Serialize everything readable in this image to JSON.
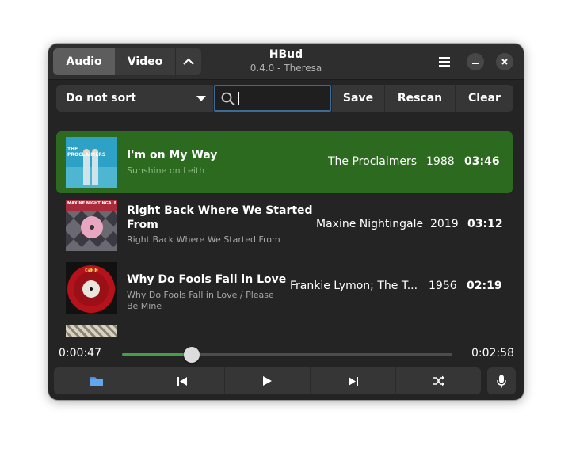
{
  "app": {
    "title": "HBud",
    "subtitle": "0.4.0 - Theresa"
  },
  "header": {
    "tabs": [
      {
        "label": "Audio",
        "active": true
      },
      {
        "label": "Video",
        "active": false
      }
    ],
    "collapse_icon": "chevron-up-icon",
    "menu_icon": "hamburger-menu-icon",
    "minimize_icon": "minimize-icon",
    "close_icon": "close-icon"
  },
  "toolbar": {
    "sort_value": "Do not sort",
    "search_value": "",
    "save_label": "Save",
    "rescan_label": "Rescan",
    "clear_label": "Clear"
  },
  "tracks": [
    {
      "title": "I'm on My Way",
      "title_line2": "",
      "album": "Sunshine on Leith",
      "album_line2": "",
      "artist": "The Proclaimers",
      "year": "1988",
      "duration": "03:46",
      "selected": true,
      "art_text": "THE PROCLAIMERS"
    },
    {
      "title": "Right Back Where We Started",
      "title_line2": "From",
      "album": "Right Back Where We Started From",
      "album_line2": "",
      "artist": "Maxine Nightingale",
      "year": "2019",
      "duration": "03:12",
      "selected": false,
      "art_text": "MAXINE NIGHTINGALE"
    },
    {
      "title": "Why Do Fools Fall in Love",
      "title_line2": "",
      "album": "Why Do Fools Fall in Love / Please",
      "album_line2": "Be Mine",
      "artist": "Frankie Lymon; The T...",
      "year": "1956",
      "duration": "02:19",
      "selected": false,
      "art_text": "GEE"
    }
  ],
  "player": {
    "elapsed": "0:00:47",
    "total": "0:02:58",
    "progress_fraction": 0.21
  },
  "colors": {
    "accent_selected": "#2b6a1f",
    "progress_fill": "#43a047",
    "search_border": "#3e6b95"
  }
}
